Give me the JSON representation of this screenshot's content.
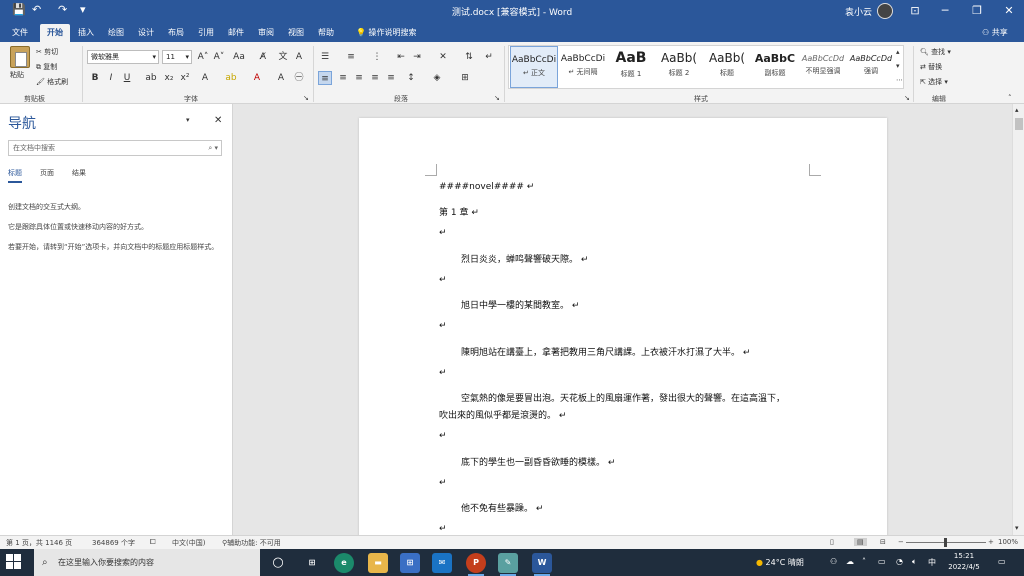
{
  "titlebar": {
    "doc_title": "测试.docx [兼容模式] - Word",
    "user_name": "袁小云",
    "save_icon": "save-icon",
    "undo_icon": "undo-icon",
    "redo_icon": "redo-icon"
  },
  "tabs": [
    "文件",
    "开始",
    "插入",
    "绘图",
    "设计",
    "布局",
    "引用",
    "邮件",
    "审阅",
    "视图",
    "帮助"
  ],
  "tell_me": "操作说明搜索",
  "share": "共享",
  "ribbon": {
    "clipboard": {
      "paste": "粘贴",
      "cut": "剪切",
      "copy": "复制",
      "format_painter": "格式刷",
      "label": "剪贴板"
    },
    "font": {
      "name": "微软雅黑",
      "size": "11",
      "label": "字体"
    },
    "paragraph": {
      "label": "段落"
    },
    "styles": {
      "label": "样式",
      "items": [
        {
          "preview": "AaBbCcDi",
          "name": "正文"
        },
        {
          "preview": "AaBbCcDi",
          "name": "无间隔"
        },
        {
          "preview": "AaB",
          "name": "标题 1"
        },
        {
          "preview": "AaBb(",
          "name": "标题 2"
        },
        {
          "preview": "AaBb(",
          "name": "标题"
        },
        {
          "preview": "AaBbC",
          "name": "副标题"
        },
        {
          "preview": "AaBbCcDd",
          "name": "不明显强调"
        },
        {
          "preview": "AaBbCcDd",
          "name": "强调"
        }
      ]
    },
    "editing": {
      "find": "查找",
      "replace": "替换",
      "select": "选择",
      "label": "编辑"
    }
  },
  "nav": {
    "title": "导航",
    "search_placeholder": "在文档中搜索",
    "tabs": [
      "标题",
      "页面",
      "结果"
    ],
    "text1": "创建文档的交互式大纲。",
    "text2": "它是跟踪具体位置或快速移动内容的好方式。",
    "text3": "若要开始，请转到“开始”选项卡，并向文档中的标题应用标题样式。"
  },
  "document": {
    "paragraphs": [
      "####novel####",
      "第 1 章",
      "",
      "烈日炎炎，蝉鸣聲響破天際。",
      "",
      "旭日中學一樓的某間教室。",
      "",
      "陳明旭站在講臺上，拿著把教用三角尺講課。上衣被汗水打濕了大半。",
      "",
      "空氣熱的像是要冒出泡。天花板上的風扇運作著，發出很大的聲響。在這高溫下，",
      "吹出來的風似乎都是滾燙的。",
      "",
      "底下的學生也一副昏昏欲睡的模樣。",
      "",
      "他不免有些暴躁。",
      ""
    ],
    "para_mark": "↵"
  },
  "status": {
    "page": "第 1 页，共 1146 页",
    "words": "364869 个字",
    "lang": "中文(中国)",
    "accessibility": "辅助功能: 不可用",
    "zoom": "100%"
  },
  "taskbar": {
    "search_placeholder": "在这里输入你要搜索的内容",
    "weather": "24°C 晴朗",
    "ime": "中",
    "time": "15:21",
    "date": "2022/4/5"
  }
}
